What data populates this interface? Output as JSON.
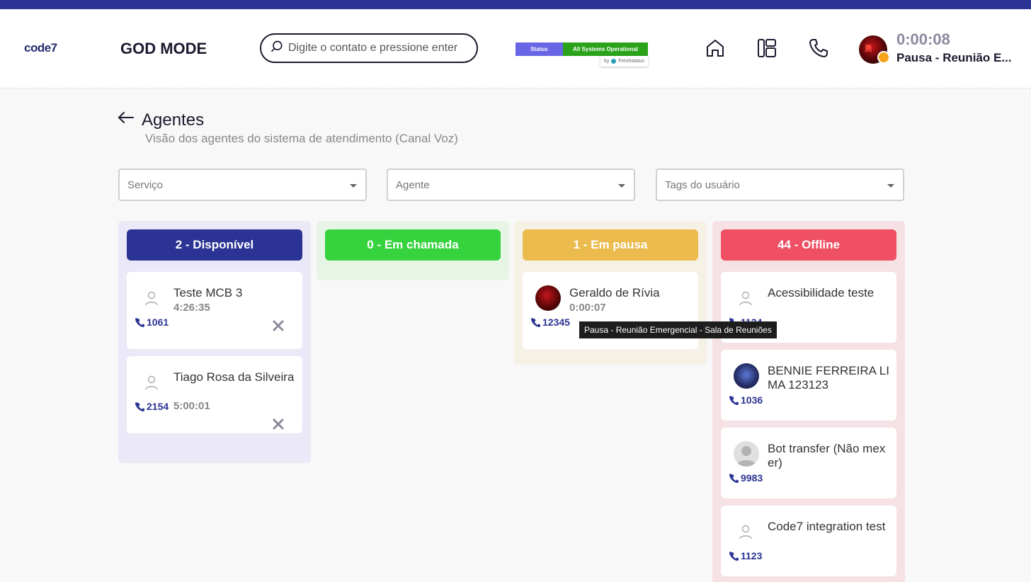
{
  "header": {
    "logo": "code7",
    "title": "GOD MODE",
    "search_placeholder": "Digite o contato e pressione enter",
    "status_label": "Status",
    "status_value": "All Systems Operational",
    "status_by": "by",
    "status_provider": "Freshstatus",
    "timer": "0:00:08",
    "pause_label": "Pausa - Reunião E..."
  },
  "page": {
    "title": "Agentes",
    "subtitle": "Visão dos agentes do sistema de atendimento (Canal Voz)"
  },
  "filters": {
    "service": "Serviço",
    "agent": "Agente",
    "tags": "Tags do usuário"
  },
  "columns": [
    {
      "title": "2 - Disponível",
      "color": "#2b3494",
      "bg": "#ebe9f7",
      "agents": [
        {
          "name": "Teste MCB 3",
          "time": "4:26:35",
          "ext": "1061"
        },
        {
          "name": "Tiago Rosa da Silveira",
          "time": "5:00:01",
          "ext": "2154"
        }
      ]
    },
    {
      "title": "0 - Em chamada",
      "color": "#36d33f",
      "bg": "#e6f5e6",
      "agents": []
    },
    {
      "title": "1 - Em pausa",
      "color": "#ecbb4e",
      "bg": "#f6f1e5",
      "agents": [
        {
          "name": "Geraldo de Rívia",
          "time": "0:00:07",
          "ext": "12345"
        }
      ]
    },
    {
      "title": "44 - Offline",
      "color": "#ef5064",
      "bg": "#f6e2e5",
      "agents": [
        {
          "name": "Acessibilidade teste",
          "ext": "1124"
        },
        {
          "name": "BENNIE FERREIRA LIMA 123123",
          "ext": "1036"
        },
        {
          "name": "Bot transfer (Não mexer)",
          "ext": "9983"
        },
        {
          "name": "Code7 integration test",
          "ext": "1123"
        }
      ]
    }
  ],
  "tooltip": "Pausa - Reunião Emergencial - Sala de Reuniões"
}
